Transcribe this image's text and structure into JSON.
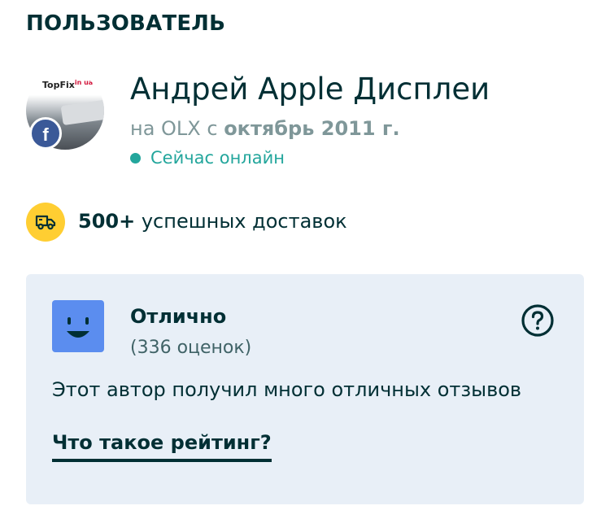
{
  "section": {
    "title": "ПОЛЬЗОВАТЕЛЬ"
  },
  "user": {
    "avatar_logo": "TopFix",
    "avatar_logo_suffix": "in ua",
    "facebook_letter": "f",
    "name": "Андрей Apple Дисплеи",
    "member_prefix": "на OLX с ",
    "member_since": "октябрь 2011 г.",
    "status": "Сейчас онлайн"
  },
  "delivery": {
    "count": "500+",
    "text": " успешных доставок"
  },
  "rating": {
    "title": "Отлично",
    "count": "(336 оценок)",
    "description": "Этот автор получил много отличных отзывов",
    "link": "Что такое рейтинг?"
  },
  "colors": {
    "text": "#002f34",
    "online": "#23a69c",
    "delivery_badge": "#ffce32",
    "card_bg": "#e8eff7",
    "smiley": "#5b8def",
    "facebook": "#3b5998"
  },
  "icons": {
    "facebook": "facebook-icon",
    "delivery": "delivery-truck-icon",
    "rating": "smiley-icon",
    "help": "question-mark-icon",
    "online": "online-dot-icon"
  }
}
